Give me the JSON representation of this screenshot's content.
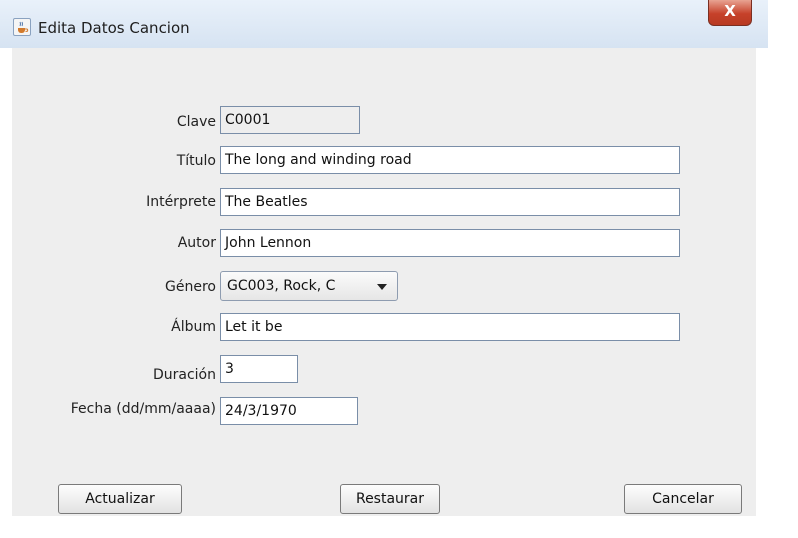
{
  "window": {
    "title": "Edita Datos Cancion",
    "close_glyph": "X",
    "icon": "java-cup-icon"
  },
  "form": {
    "clave": {
      "label": "Clave",
      "value": "C0001"
    },
    "titulo": {
      "label": "Título",
      "value": "The long and winding road"
    },
    "interprete": {
      "label": "Intérprete",
      "value": "The Beatles"
    },
    "autor": {
      "label": "Autor",
      "value": "John Lennon"
    },
    "genero": {
      "label": "Género",
      "value": "GC003, Rock, C"
    },
    "album": {
      "label": "Álbum",
      "value": "Let it be"
    },
    "duracion": {
      "label": "Duración",
      "value": "3"
    },
    "fecha": {
      "label": "Fecha (dd/mm/aaaa)",
      "value": "24/3/1970"
    }
  },
  "buttons": {
    "actualizar": "Actualizar",
    "restaurar": "Restaurar",
    "cancelar": "Cancelar"
  },
  "colors": {
    "close_button": "#c6412a",
    "panel_background": "#eeeeee",
    "titlebar": "#d6e3f2"
  }
}
